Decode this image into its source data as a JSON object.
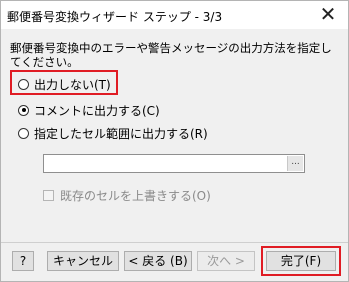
{
  "window": {
    "title": "郵便番号変換ウィザード ステップ - 3/3",
    "close_glyph": "✕"
  },
  "description": "郵便番号変換中のエラーや警告メッセージの出力方法を指定してください。",
  "options": [
    {
      "label": "出力しない(T)",
      "selected": false
    },
    {
      "label": "コメントに出力する(C)",
      "selected": true
    },
    {
      "label": "指定したセル範囲に出力する(R)",
      "selected": false
    }
  ],
  "range_field": {
    "value": "",
    "button_label": "..."
  },
  "overwrite_checkbox": {
    "label": "既存のセルを上書きする(O)",
    "checked": false,
    "enabled": false
  },
  "buttons": {
    "help": "?",
    "cancel": "キャンセル",
    "back": "< 戻る (B)",
    "next": "次へ >",
    "finish": "完了(F)"
  },
  "highlight_color": "#e01c24"
}
